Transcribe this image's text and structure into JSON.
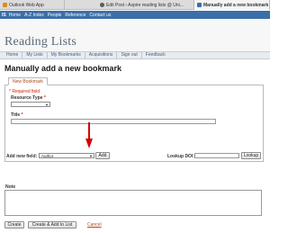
{
  "browser": {
    "tabs": [
      {
        "label": "Outlook Web App",
        "icon_color": "#e08a1c"
      },
      {
        "label": "Edit Post ‹ Aspire reading lists @ Uni...",
        "icon_color": "#5a5a5a"
      },
      {
        "label": "Manually add a new bookmark",
        "icon_color": "#3b6fa8"
      }
    ]
  },
  "unibar": {
    "badge": "IS",
    "links": [
      "Home",
      "A-Z Index",
      "People",
      "Reference",
      "Contact us"
    ]
  },
  "header": {
    "title": "Reading Lists"
  },
  "nav": {
    "items": [
      "Home",
      "My Lists",
      "My Bookmarks",
      "Acquisitions",
      "Sign out",
      "Feedback"
    ]
  },
  "page": {
    "heading": "Manually add a new bookmark"
  },
  "form": {
    "tab_label": "New Bookmark",
    "required_note": "* Required field",
    "resource_type_label": "Resource Type",
    "resource_type_value": "",
    "title_label": "Title",
    "title_value": "",
    "add_new_field_label": "Add new field:",
    "add_new_field_value": "Author",
    "add_button": "Add",
    "lookup_doi_label": "Lookup DOI:",
    "lookup_doi_value": "",
    "lookup_button": "Lookup",
    "required_star": "*"
  },
  "note": {
    "label": "Note",
    "value": ""
  },
  "actions": {
    "create": "Create",
    "create_add": "Create & Add to List",
    "cancel": "Cancel"
  },
  "colors": {
    "accent": "#3b6fa8",
    "required": "#cc2200",
    "link": "#b04a1a",
    "arrow": "#d40000"
  }
}
